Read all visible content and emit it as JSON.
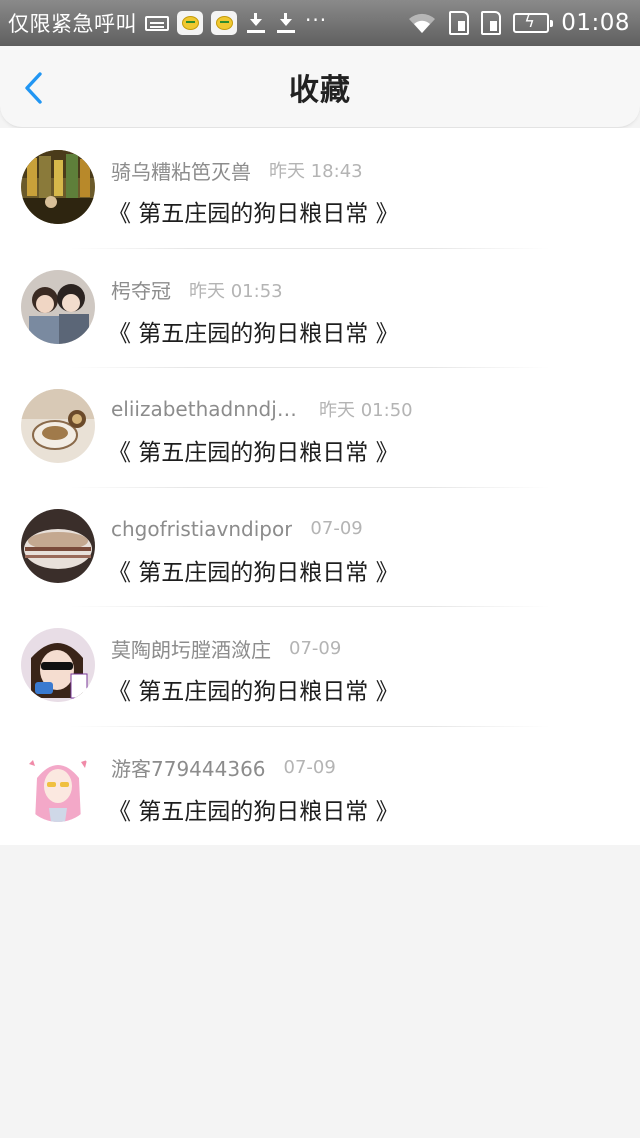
{
  "status_bar": {
    "carrier": "仅限紧急呼叫",
    "more": "···",
    "time": "01:08",
    "battery_level": 0.85,
    "battery_color": "#6ed04a"
  },
  "header": {
    "title": "收藏",
    "back_icon": "chevron-left-icon",
    "accent_color": "#2196f3"
  },
  "items": [
    {
      "username": "骑乌糟粘笆灭兽",
      "time": "昨天 18:43",
      "title": "《 第五庄园的狗日粮日常 》"
    },
    {
      "username": "枵夺冠",
      "time": "昨天 01:53",
      "title": "《 第五庄园的狗日粮日常 》"
    },
    {
      "username": "eliizabethadnndja...",
      "time": "昨天 01:50",
      "title": "《 第五庄园的狗日粮日常 》"
    },
    {
      "username": "chgofristiavndipor",
      "time": "07-09",
      "title": "《 第五庄园的狗日粮日常 》"
    },
    {
      "username": "莫陶朗圬膛酒潋庄",
      "time": "07-09",
      "title": "《 第五庄园的狗日粮日常 》"
    },
    {
      "username": "游客779444366",
      "time": "07-09",
      "title": "《 第五庄园的狗日粮日常 》"
    }
  ]
}
